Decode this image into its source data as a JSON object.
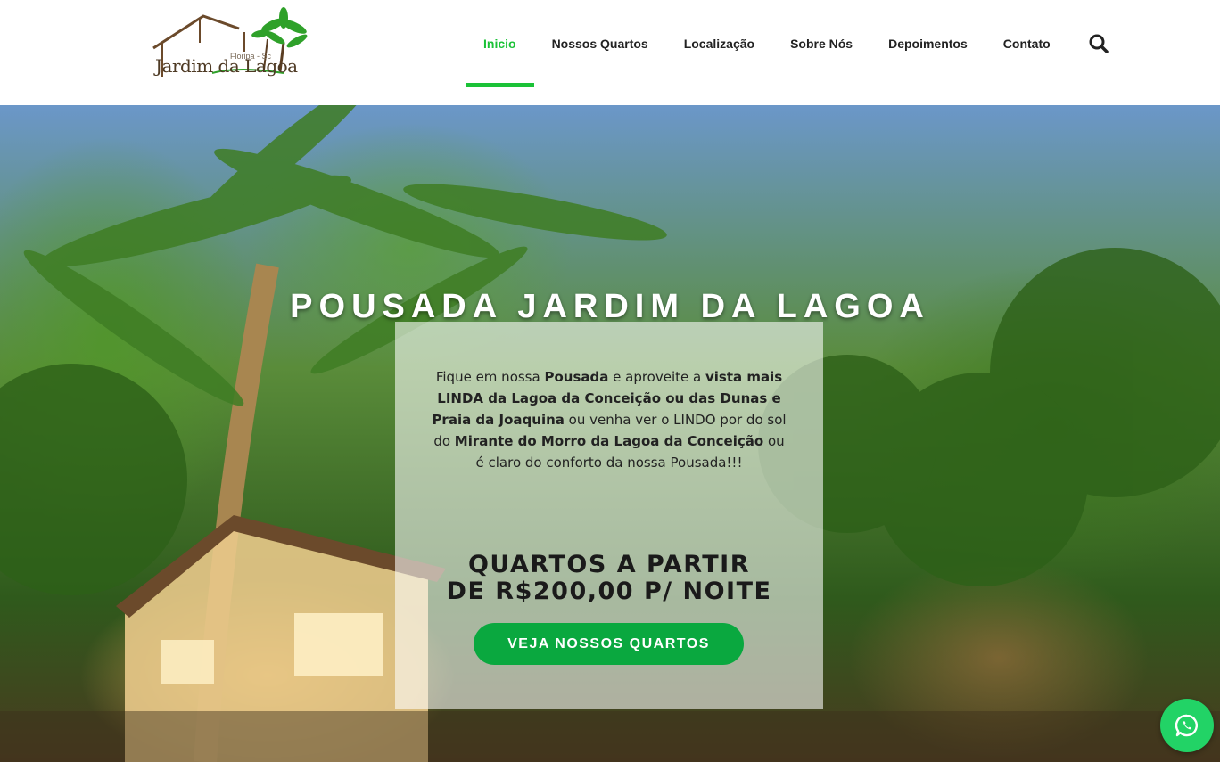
{
  "header": {
    "logo": {
      "name": "Jardim da Lagoa",
      "subtitle": "Floripa - Sc"
    },
    "nav": {
      "items": [
        {
          "label": "Inicio",
          "active": true
        },
        {
          "label": "Nossos Quartos"
        },
        {
          "label": "Localização"
        },
        {
          "label": "Sobre Nós"
        },
        {
          "label": "Depoimentos"
        },
        {
          "label": "Contato"
        }
      ],
      "search_icon": "search-icon",
      "active_color": "#1bc237"
    }
  },
  "hero": {
    "title": "POUSADA JARDIM DA LAGOA",
    "intro": {
      "t1": "Fique em nossa ",
      "b1": "Pousada",
      "t2": " e aproveite a ",
      "b2": "vista mais LINDA da Lagoa da Conceição ou das Dunas e Praia da Joaquina",
      "t3": " ou venha ver o LINDO por do sol do ",
      "b3": "Mirante do Morro da Lagoa da Conceição",
      "t4": " ou é claro do conforto da nossa Pousada!!!"
    },
    "price_line1": "QUARTOS A PARTIR",
    "price_line2": "DE R$200,00 P/ NOITE",
    "cta_label": "VEJA NOSSOS QUARTOS",
    "cta_color": "#0aa83f"
  },
  "floating": {
    "whatsapp_icon": "whatsapp-icon",
    "color": "#22d366"
  }
}
